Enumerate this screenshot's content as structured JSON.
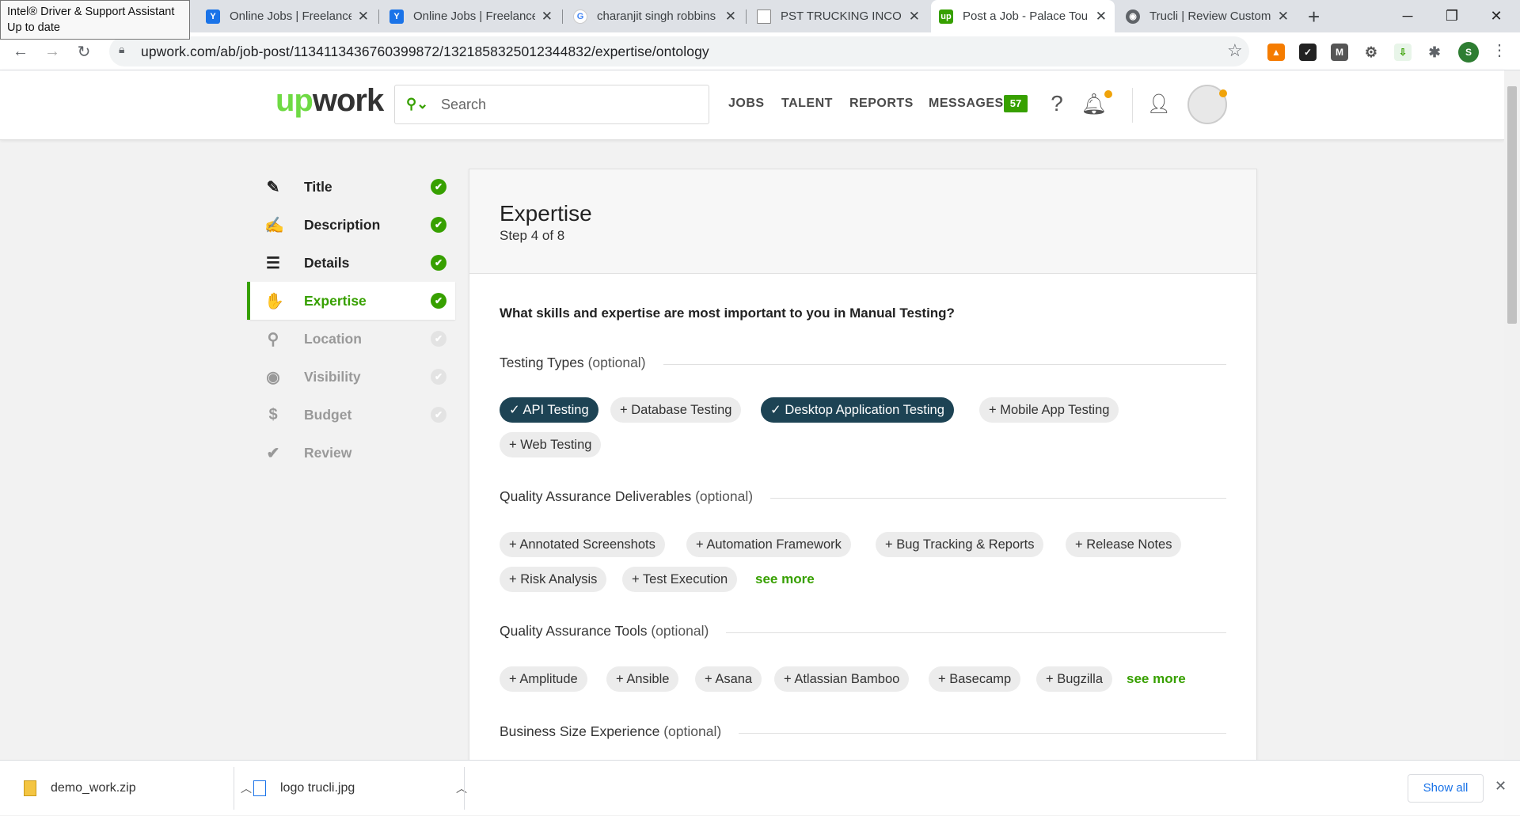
{
  "browser": {
    "tooltip": {
      "line1": "Intel® Driver & Support Assistant",
      "line2": "Up to date"
    },
    "tabs": [
      {
        "title": "Online Jobs | Freelance",
        "icon": "upwork-y-icon"
      },
      {
        "title": "Online Jobs | Freelance",
        "icon": "upwork-y-icon"
      },
      {
        "title": "charanjit singh robbins",
        "icon": "google-icon"
      },
      {
        "title": "PST TRUCKING INCORI",
        "icon": "document-icon"
      },
      {
        "title": "Post a Job - Palace Tou",
        "icon": "upwork-icon",
        "active": true
      },
      {
        "title": "Trucli | Review Custome",
        "icon": "globe-icon"
      }
    ],
    "new_tab": "+",
    "url": "upwork.com/ab/job-post/1134113436760399872/1321858325012344832/expertise/ontology",
    "profile_initial": "S"
  },
  "header": {
    "logo_up": "up",
    "logo_work": "work",
    "search_placeholder": "Search",
    "nav": [
      "JOBS",
      "TALENT",
      "REPORTS",
      "MESSAGES"
    ],
    "messages_count": "57",
    "accent": "#37a000"
  },
  "sidebar": {
    "items": [
      {
        "label": "Title",
        "icon": "pencil-icon",
        "state": "done"
      },
      {
        "label": "Description",
        "icon": "edit-icon",
        "state": "done"
      },
      {
        "label": "Details",
        "icon": "list-icon",
        "state": "done"
      },
      {
        "label": "Expertise",
        "icon": "hand-icon",
        "state": "active"
      },
      {
        "label": "Location",
        "icon": "map-pin-icon",
        "state": "pending"
      },
      {
        "label": "Visibility",
        "icon": "eye-person-icon",
        "state": "pending"
      },
      {
        "label": "Budget",
        "icon": "dollar-icon",
        "state": "pending"
      },
      {
        "label": "Review",
        "icon": "checkmark-icon",
        "state": "pending"
      }
    ]
  },
  "main": {
    "title": "Expertise",
    "step": "Step 4 of 8",
    "question": "What skills and expertise are most important to you in Manual Testing?",
    "sections": [
      {
        "title": "Testing Types",
        "optional": "(optional)",
        "chips": [
          {
            "label": "API Testing",
            "selected": true
          },
          {
            "label": "Database Testing",
            "selected": false
          },
          {
            "label": "Desktop Application Testing",
            "selected": true
          },
          {
            "label": "Mobile App Testing",
            "selected": false
          },
          {
            "label": "Web Testing",
            "selected": false
          }
        ]
      },
      {
        "title": "Quality Assurance Deliverables",
        "optional": "(optional)",
        "chips": [
          {
            "label": "Annotated Screenshots",
            "selected": false
          },
          {
            "label": "Automation Framework",
            "selected": false
          },
          {
            "label": "Bug Tracking & Reports",
            "selected": false
          },
          {
            "label": "Release Notes",
            "selected": false
          },
          {
            "label": "Risk Analysis",
            "selected": false
          },
          {
            "label": "Test Execution",
            "selected": false
          }
        ],
        "see_more": "see more"
      },
      {
        "title": "Quality Assurance Tools",
        "optional": "(optional)",
        "chips": [
          {
            "label": "Amplitude",
            "selected": false
          },
          {
            "label": "Ansible",
            "selected": false
          },
          {
            "label": "Asana",
            "selected": false
          },
          {
            "label": "Atlassian Bamboo",
            "selected": false
          },
          {
            "label": "Basecamp",
            "selected": false
          },
          {
            "label": "Bugzilla",
            "selected": false
          }
        ],
        "see_more": "see more"
      },
      {
        "title": "Business Size Experience",
        "optional": "(optional)"
      }
    ]
  },
  "downloads": {
    "files": [
      {
        "name": "demo_work.zip",
        "icon": "zip-file-icon"
      },
      {
        "name": "logo trucli.jpg",
        "icon": "image-file-icon"
      }
    ],
    "show_all": "Show all"
  }
}
